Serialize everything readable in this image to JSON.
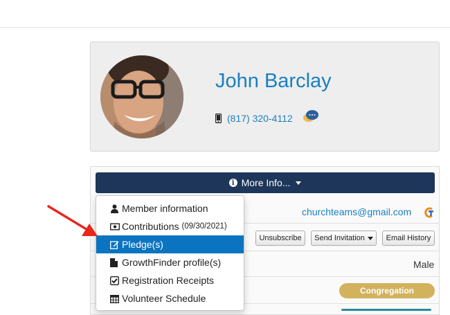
{
  "profile": {
    "name": "John Barclay",
    "phone": "(817) 320-4112"
  },
  "panel": {
    "more_info_label": "More Info...",
    "email": "churchteams@gmail.com",
    "buttons": {
      "unsubscribe": "Unsubscribe",
      "send_invitation": "Send Invitation",
      "email_history": "Email History"
    },
    "gender": "Male",
    "membership_badge": "Congregation"
  },
  "dropdown": {
    "items": [
      {
        "label": "Member information",
        "icon": "user-icon"
      },
      {
        "label": "Contributions",
        "suffix": "(09/30/2021)",
        "icon": "money-icon"
      },
      {
        "label": "Pledge(s)",
        "icon": "edit-icon",
        "active": true
      },
      {
        "label": "GrowthFinder profile(s)",
        "icon": "file-icon"
      },
      {
        "label": "Registration Receipts",
        "icon": "checkbox-icon"
      },
      {
        "label": "Volunteer Schedule",
        "icon": "calendar-icon"
      }
    ]
  },
  "colors": {
    "link": "#1a7fc1",
    "header_button": "#1d3659",
    "active_item": "#0a74c0",
    "badge": "#d2b25d",
    "arrow": "#e8261c"
  }
}
